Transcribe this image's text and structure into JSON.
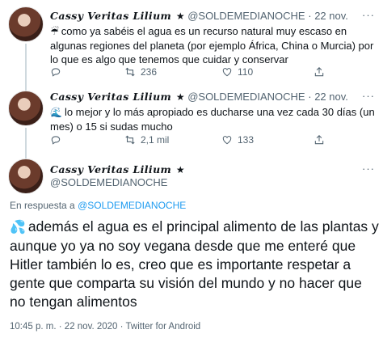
{
  "tweets": [
    {
      "name": "Cassy Veritas Lilium",
      "badge": "★",
      "handle": "@SOLDEMEDIANOCHE",
      "dot": "·",
      "date": "22 nov.",
      "emoji": "☔",
      "text": "como ya sabéis el agua es un recurso natural muy escaso en algunas regiones del planeta (por ejemplo África, China o Murcia) por lo que es algo que tenemos que cuidar y conservar",
      "retweets": "236",
      "likes": "110"
    },
    {
      "name": "Cassy Veritas Lilium",
      "badge": "★",
      "handle": "@SOLDEMEDIANOCHE",
      "dot": "·",
      "date": "22 nov.",
      "emoji": "🌊",
      "text": "lo mejor y lo más apropiado es ducharse una vez cada 30 días (un mes) o 15 si sudas mucho",
      "retweets": "2,1 mil",
      "likes": "133"
    }
  ],
  "main_tweet": {
    "name": "Cassy Veritas Lilium",
    "badge": "★",
    "handle": "@SOLDEMEDIANOCHE",
    "reply_prefix": "En respuesta a",
    "reply_handle": "@SOLDEMEDIANOCHE",
    "emoji": "💦",
    "text": "además el agua es el principal alimento de las plantas y aunque yo ya no soy vegana desde que me enteré que Hitler también lo es, creo que es importante respetar a gente que comparta su visión del mundo y no hacer que no tengan alimentos",
    "time": "10:45 p. m.",
    "dot": "·",
    "date": "22 nov. 2020",
    "source": "Twitter for Android"
  },
  "more_label": "···",
  "colors": {
    "text": "#0f1419",
    "secondary": "#536471",
    "link": "#1d9bf0",
    "line": "#cfd9de"
  },
  "icons": [
    "reply-icon",
    "retweet-icon",
    "like-icon",
    "share-icon",
    "more-icon"
  ]
}
